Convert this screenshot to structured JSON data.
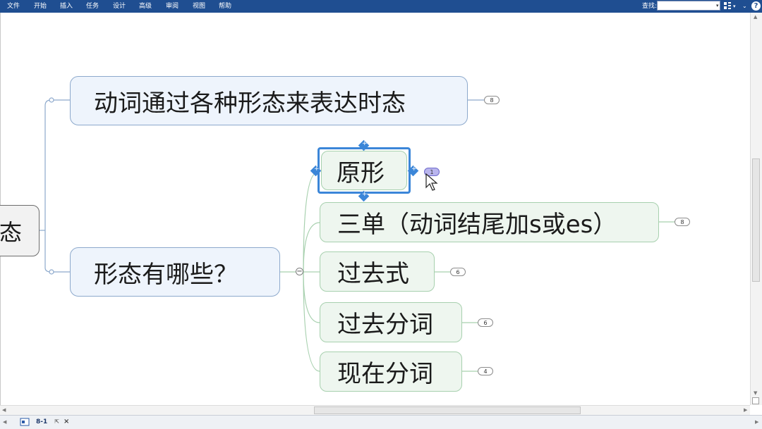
{
  "ribbon": {
    "tabs": [
      "文件",
      "开始",
      "插入",
      "任务",
      "设计",
      "高级",
      "审阅",
      "视图",
      "帮助"
    ],
    "find_label": "查找:",
    "find_value": "",
    "help_icon": "?"
  },
  "mindmap": {
    "central_fragment": "态",
    "main_topic_1": "动词通过各种形态来表达时态",
    "main_topic_1_count": "8",
    "main_topic_2": "形态有哪些？",
    "subtopics": [
      {
        "label": "原形",
        "count": "1"
      },
      {
        "label": "三单（动词结尾加s或es）",
        "count": "8"
      },
      {
        "label": "过去式",
        "count": "6"
      },
      {
        "label": "过去分词",
        "count": "6"
      },
      {
        "label": "现在分词",
        "count": "4"
      }
    ],
    "collapse_symbol": "−"
  },
  "status": {
    "doc_tab_label": "8-1",
    "close_symbol": "×"
  },
  "colors": {
    "ribbon": "#1f4e91",
    "topic_blue_fill": "#eef4fc",
    "topic_blue_border": "#8da9cc",
    "topic_green_fill": "#eef6ef",
    "topic_green_border": "#a7d0ae",
    "selection": "#3b86d8"
  }
}
